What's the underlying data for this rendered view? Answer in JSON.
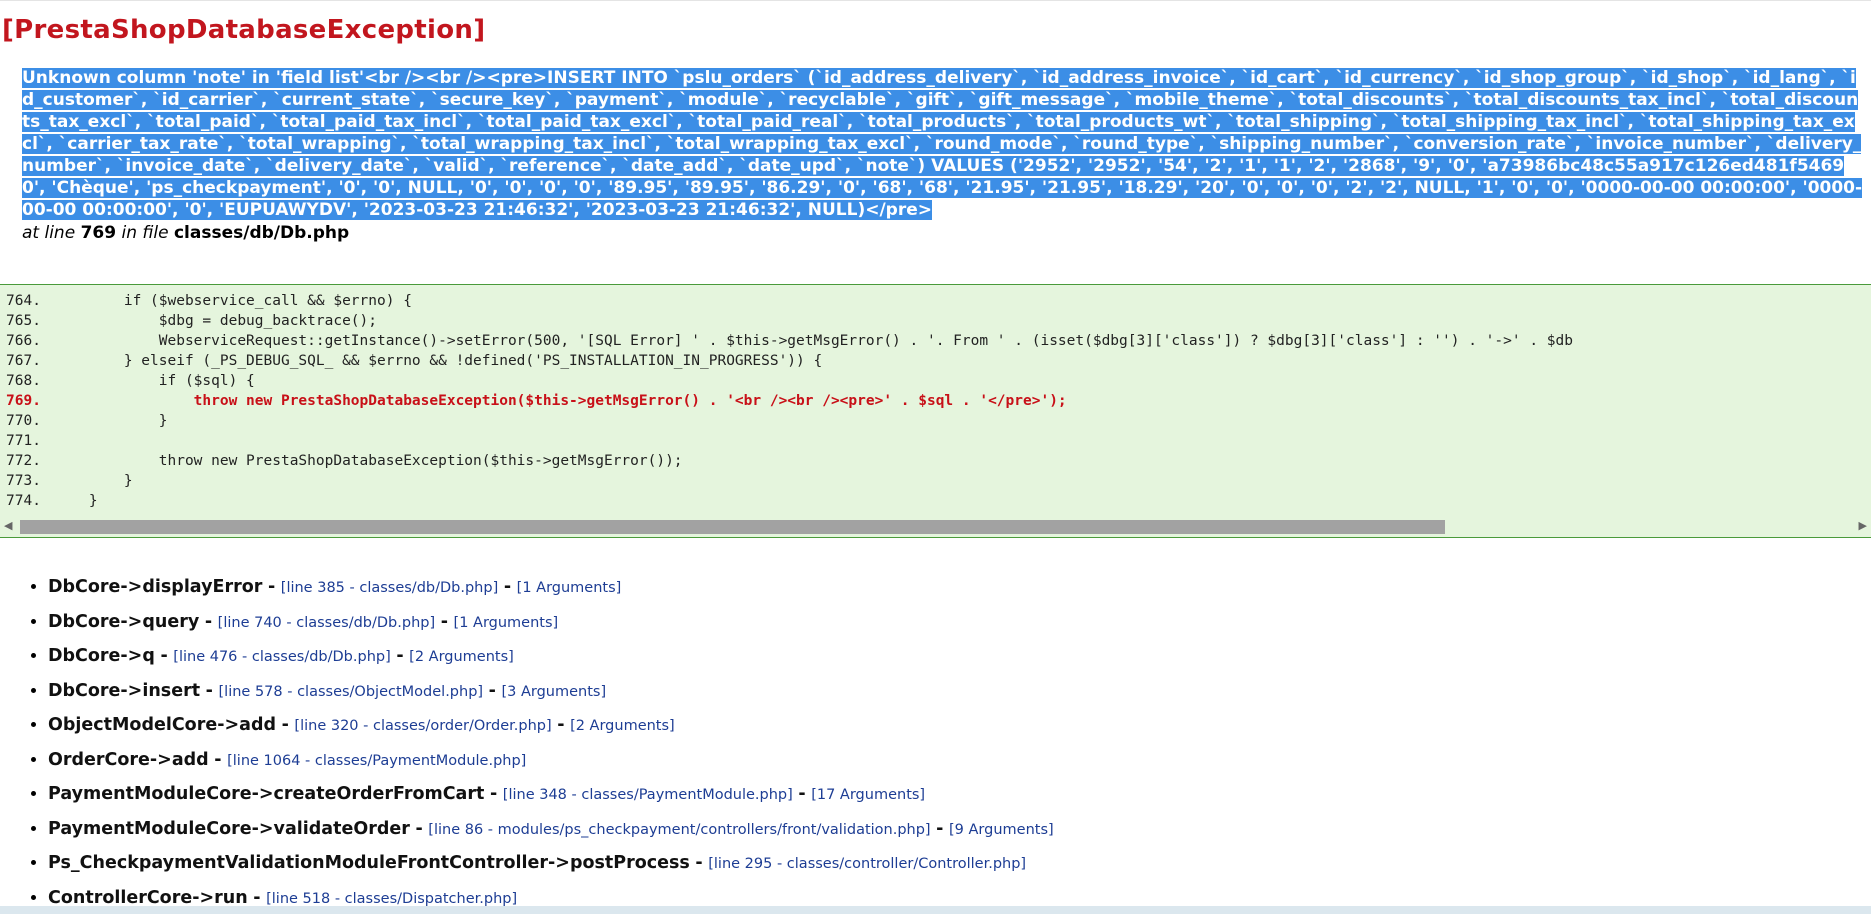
{
  "exception": {
    "title": "[PrestaShopDatabaseException]",
    "message": "Unknown column 'note' in 'field list'<br /><br /><pre>INSERT INTO `pslu_orders` (`id_address_delivery`, `id_address_invoice`, `id_cart`, `id_currency`, `id_shop_group`, `id_shop`, `id_lang`, `id_customer`, `id_carrier`, `current_state`, `secure_key`, `payment`, `module`, `recyclable`, `gift`, `gift_message`, `mobile_theme`, `total_discounts`, `total_discounts_tax_incl`, `total_discounts_tax_excl`, `total_paid`, `total_paid_tax_incl`, `total_paid_tax_excl`, `total_paid_real`, `total_products`, `total_products_wt`, `total_shipping`, `total_shipping_tax_incl`, `total_shipping_tax_excl`, `carrier_tax_rate`, `total_wrapping`, `total_wrapping_tax_incl`, `total_wrapping_tax_excl`, `round_mode`, `round_type`, `shipping_number`, `conversion_rate`, `invoice_number`, `delivery_number`, `invoice_date`, `delivery_date`, `valid`, `reference`, `date_add`, `date_upd`, `note`) VALUES ('2952', '2952', '54', '2', '1', '1', '2', '2868', '9', '0', 'a73986bc48c55a917c126ed481f54690', 'Chèque', 'ps_checkpayment', '0', '0', NULL, '0', '0', '0', '0', '89.95', '89.95', '86.29', '0', '68', '68', '21.95', '21.95', '18.29', '20', '0', '0', '0', '2', '2', NULL, '1', '0', '0', '0000-00-00 00:00:00', '0000-00-00 00:00:00', '0', 'EUPUAWYDV', '2023-03-23 21:46:32', '2023-03-23 21:46:32', NULL)</pre>",
    "at_line_prefix": "at line",
    "line_number": "769",
    "in_file_prefix": "in file",
    "file": "classes/db/Db.php"
  },
  "code": [
    {
      "num": "764.",
      "text": "        if ($webservice_call && $errno) {",
      "highlight": false
    },
    {
      "num": "765.",
      "text": "            $dbg = debug_backtrace();",
      "highlight": false
    },
    {
      "num": "766.",
      "text": "            WebserviceRequest::getInstance()->setError(500, '[SQL Error] ' . $this->getMsgError() . '. From ' . (isset($dbg[3]['class']) ? $dbg[3]['class'] : '') . '->' . $db",
      "highlight": false
    },
    {
      "num": "767.",
      "text": "        } elseif (_PS_DEBUG_SQL_ && $errno && !defined('PS_INSTALLATION_IN_PROGRESS')) {",
      "highlight": false
    },
    {
      "num": "768.",
      "text": "            if ($sql) {",
      "highlight": false
    },
    {
      "num": "769.",
      "text": "                throw new PrestaShopDatabaseException($this->getMsgError() . '<br /><br /><pre>' . $sql . '</pre>');",
      "highlight": true
    },
    {
      "num": "770.",
      "text": "            }",
      "highlight": false
    },
    {
      "num": "771.",
      "text": "",
      "highlight": false
    },
    {
      "num": "772.",
      "text": "            throw new PrestaShopDatabaseException($this->getMsgError());",
      "highlight": false
    },
    {
      "num": "773.",
      "text": "        }",
      "highlight": false
    },
    {
      "num": "774.",
      "text": "    }",
      "highlight": false
    }
  ],
  "scrollbar": {
    "left_arrow": "◀",
    "right_arrow": "▶"
  },
  "trace": [
    {
      "fn": "DbCore->displayError",
      "sep": "-",
      "location": "[line 385 - classes/db/Db.php]",
      "args": "[1 Arguments]"
    },
    {
      "fn": "DbCore->query",
      "sep": "-",
      "location": "[line 740 - classes/db/Db.php]",
      "args": "[1 Arguments]"
    },
    {
      "fn": "DbCore->q",
      "sep": "-",
      "location": "[line 476 - classes/db/Db.php]",
      "args": "[2 Arguments]"
    },
    {
      "fn": "DbCore->insert",
      "sep": "-",
      "location": "[line 578 - classes/ObjectModel.php]",
      "args": "[3 Arguments]"
    },
    {
      "fn": "ObjectModelCore->add",
      "sep": "-",
      "location": "[line 320 - classes/order/Order.php]",
      "args": "[2 Arguments]"
    },
    {
      "fn": "OrderCore->add",
      "sep": "-",
      "location": "[line 1064 - classes/PaymentModule.php]",
      "args": ""
    },
    {
      "fn": "PaymentModuleCore->createOrderFromCart",
      "sep": "-",
      "location": "[line 348 - classes/PaymentModule.php]",
      "args": "[17 Arguments]"
    },
    {
      "fn": "PaymentModuleCore->validateOrder",
      "sep": "-",
      "location": "[line 86 - modules/ps_checkpayment/controllers/front/validation.php]",
      "args": "[9 Arguments]"
    },
    {
      "fn": "Ps_CheckpaymentValidationModuleFrontController->postProcess",
      "sep": "-",
      "location": "[line 295 - classes/controller/Controller.php]",
      "args": ""
    },
    {
      "fn": "ControllerCore->run",
      "sep": "-",
      "location": "[line 518 - classes/Dispatcher.php]",
      "args": ""
    }
  ]
}
